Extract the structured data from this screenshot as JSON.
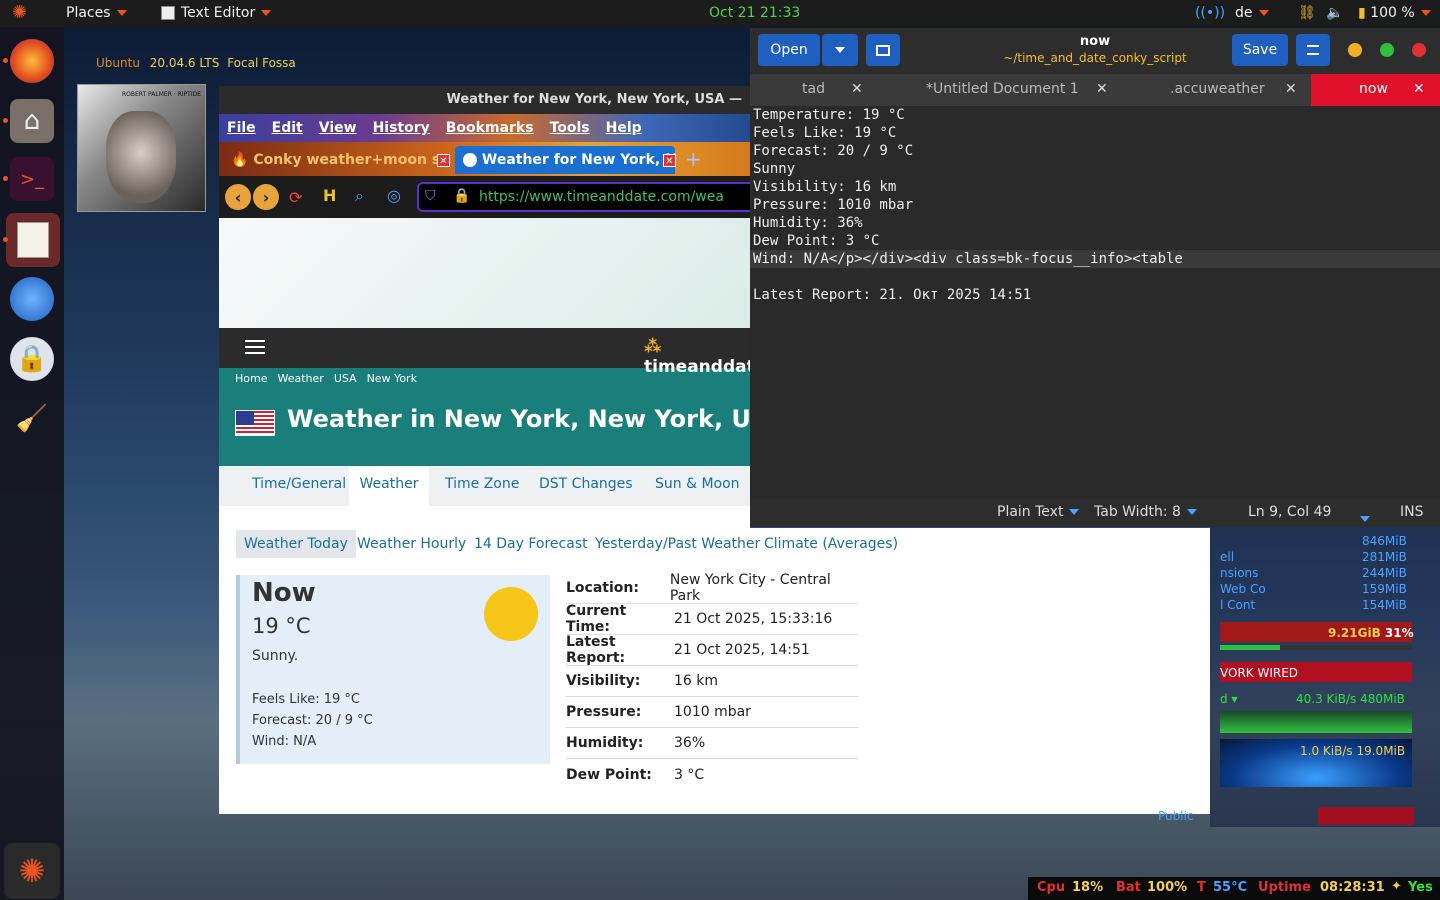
{
  "topbar": {
    "places": "Places",
    "app": "Text Editor",
    "clock": "Oct 21  21:33",
    "keyboard": "de",
    "battery": "100 %"
  },
  "dock": {
    "items": [
      "firefox-icon",
      "files-icon",
      "terminal-icon",
      "text-editor-icon",
      "thunderbird-icon",
      "keepassxc-icon",
      "bleachbit-icon",
      "ubuntu-menu-icon"
    ]
  },
  "conky_left": {
    "os": "Ubuntu",
    "version": "20.04.6 LTS",
    "codename": "Focal Fossa",
    "album_text": "ROBERT PALMER · RIPTIDE"
  },
  "browser": {
    "window_title": "Weather for New York, New York, USA —",
    "menu": [
      "File",
      "Edit",
      "View",
      "History",
      "Bookmarks",
      "Tools",
      "Help"
    ],
    "tabs": [
      {
        "label": "Conky weather+moon sc"
      },
      {
        "label": "Weather for New York, N"
      }
    ],
    "url": "https://www.timeanddate.com/wea",
    "logo": "timeanddate",
    "breadcrumb": [
      "Home",
      "Weather",
      "USA",
      "New York"
    ],
    "page_title": "Weather in New York, New York, USA",
    "nav_tabs": [
      "Time/General",
      "Weather",
      "Time Zone",
      "DST Changes",
      "Sun & Moon"
    ]
  },
  "weather": {
    "sub_links": [
      "Weather Today",
      "Weather Hourly",
      "14 Day Forecast",
      "Yesterday/Past Weather",
      "Climate (Averages)"
    ],
    "now_label": "Now",
    "temp": "19 °C",
    "condition": "Sunny.",
    "feels_like": "Feels Like: 19 °C",
    "forecast": "Forecast: 20 / 9 °C",
    "wind": "Wind: N/A",
    "table": [
      {
        "k": "Location:",
        "v": "New York City - Central Park"
      },
      {
        "k": "Current Time:",
        "v": "21 Oct 2025, 15:33:16"
      },
      {
        "k": "Latest Report:",
        "v": "21 Oct 2025, 14:51"
      },
      {
        "k": "Visibility:",
        "v": "16 km"
      },
      {
        "k": "Pressure:",
        "v": "1010 mbar"
      },
      {
        "k": "Humidity:",
        "v": "36%"
      },
      {
        "k": "Dew Point:",
        "v": "3 °C"
      }
    ]
  },
  "editor": {
    "title": "now",
    "path": "~/time_and_date_conky_script",
    "open": "Open",
    "save": "Save",
    "tabs": [
      "tad",
      "*Untitled Document 1",
      ".accuweather",
      "now"
    ],
    "lines": [
      "Temperature: 19 °C",
      "Feels Like: 19 °C",
      "Forecast: 20 / 9 °C",
      "Sunny",
      "Visibility: 16 km",
      "Pressure: 1010 mbar",
      "Humidity: 36%",
      "Dew Point: 3 °C",
      "Wind: N/A</p></div><div class=bk-focus__info><table",
      "",
      "Latest Report: 21. Окт 2025 14:51"
    ],
    "status_lang": "Plain Text",
    "status_tab": "Tab Width: 8",
    "status_pos": "Ln 9, Col 49",
    "status_mode": "INS"
  },
  "conky_right": {
    "procs": [
      {
        "name": "ell",
        "mem": "281MiB"
      },
      {
        "name": "nsions",
        "mem": "244MiB"
      },
      {
        "name": "Web Co",
        "mem": "159MiB"
      },
      {
        "name": "l Cont",
        "mem": "154MiB"
      }
    ],
    "top_mem": "846MiB",
    "ram": "9.21GiB",
    "ram_pct": "31%",
    "ram_fraction": 0.31,
    "network_label": "VORK WIRED",
    "down": "40.3 KiB/s",
    "down_total": "480MiB",
    "up": "1.0 KiB/s",
    "up_total": "19.0MiB",
    "public": "Public"
  },
  "bottombar": {
    "cpu_label": "Cpu",
    "cpu": "18%",
    "bat_label": "Bat",
    "bat": "100%",
    "temp_label": "T",
    "temp": "55°C",
    "uptime_label": "Uptime",
    "uptime": "08:28:31",
    "yes": "Yes"
  },
  "colors": {
    "accent": "#e95420",
    "teal": "#1a7e7a",
    "editor_blue": "#1e5fbf"
  }
}
